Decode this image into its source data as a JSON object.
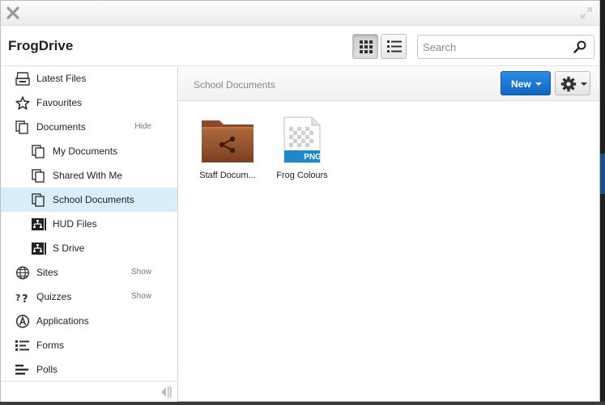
{
  "window": {
    "title": "FrogDrive"
  },
  "header": {
    "title": "FrogDrive",
    "search_placeholder": "Search",
    "view_modes": [
      "grid",
      "list"
    ],
    "active_view": "grid"
  },
  "sidebar": {
    "items": [
      {
        "label": "Latest Files",
        "icon": "latest-files-icon"
      },
      {
        "label": "Favourites",
        "icon": "star-icon"
      },
      {
        "label": "Documents",
        "icon": "documents-icon",
        "action": "Hide"
      },
      {
        "label": "My Documents",
        "icon": "documents-icon"
      },
      {
        "label": "Shared With Me",
        "icon": "documents-icon"
      },
      {
        "label": "School Documents",
        "icon": "documents-icon",
        "selected": true
      },
      {
        "label": "HUD Files",
        "icon": "network-drive-icon"
      },
      {
        "label": "S Drive",
        "icon": "network-drive-icon"
      },
      {
        "label": "Sites",
        "icon": "globe-icon",
        "action": "Show"
      },
      {
        "label": "Quizzes",
        "icon": "quiz-icon",
        "action": "Show"
      },
      {
        "label": "Applications",
        "icon": "applications-icon"
      },
      {
        "label": "Forms",
        "icon": "forms-icon"
      },
      {
        "label": "Polls",
        "icon": "polls-icon"
      }
    ]
  },
  "content": {
    "breadcrumb": "School Documents",
    "new_button": "New",
    "files": [
      {
        "name": "Staff Documents",
        "display_name": "Staff Docum...",
        "type": "shared-folder"
      },
      {
        "name": "Frog Colours",
        "display_name": "Frog Colours",
        "type": "png",
        "badge": "PNG"
      }
    ]
  },
  "colors": {
    "accent": "#0d66c2",
    "selected_bg": "#d9eef9",
    "folder": "#8e4f2b",
    "png_badge": "#1e88c8"
  }
}
